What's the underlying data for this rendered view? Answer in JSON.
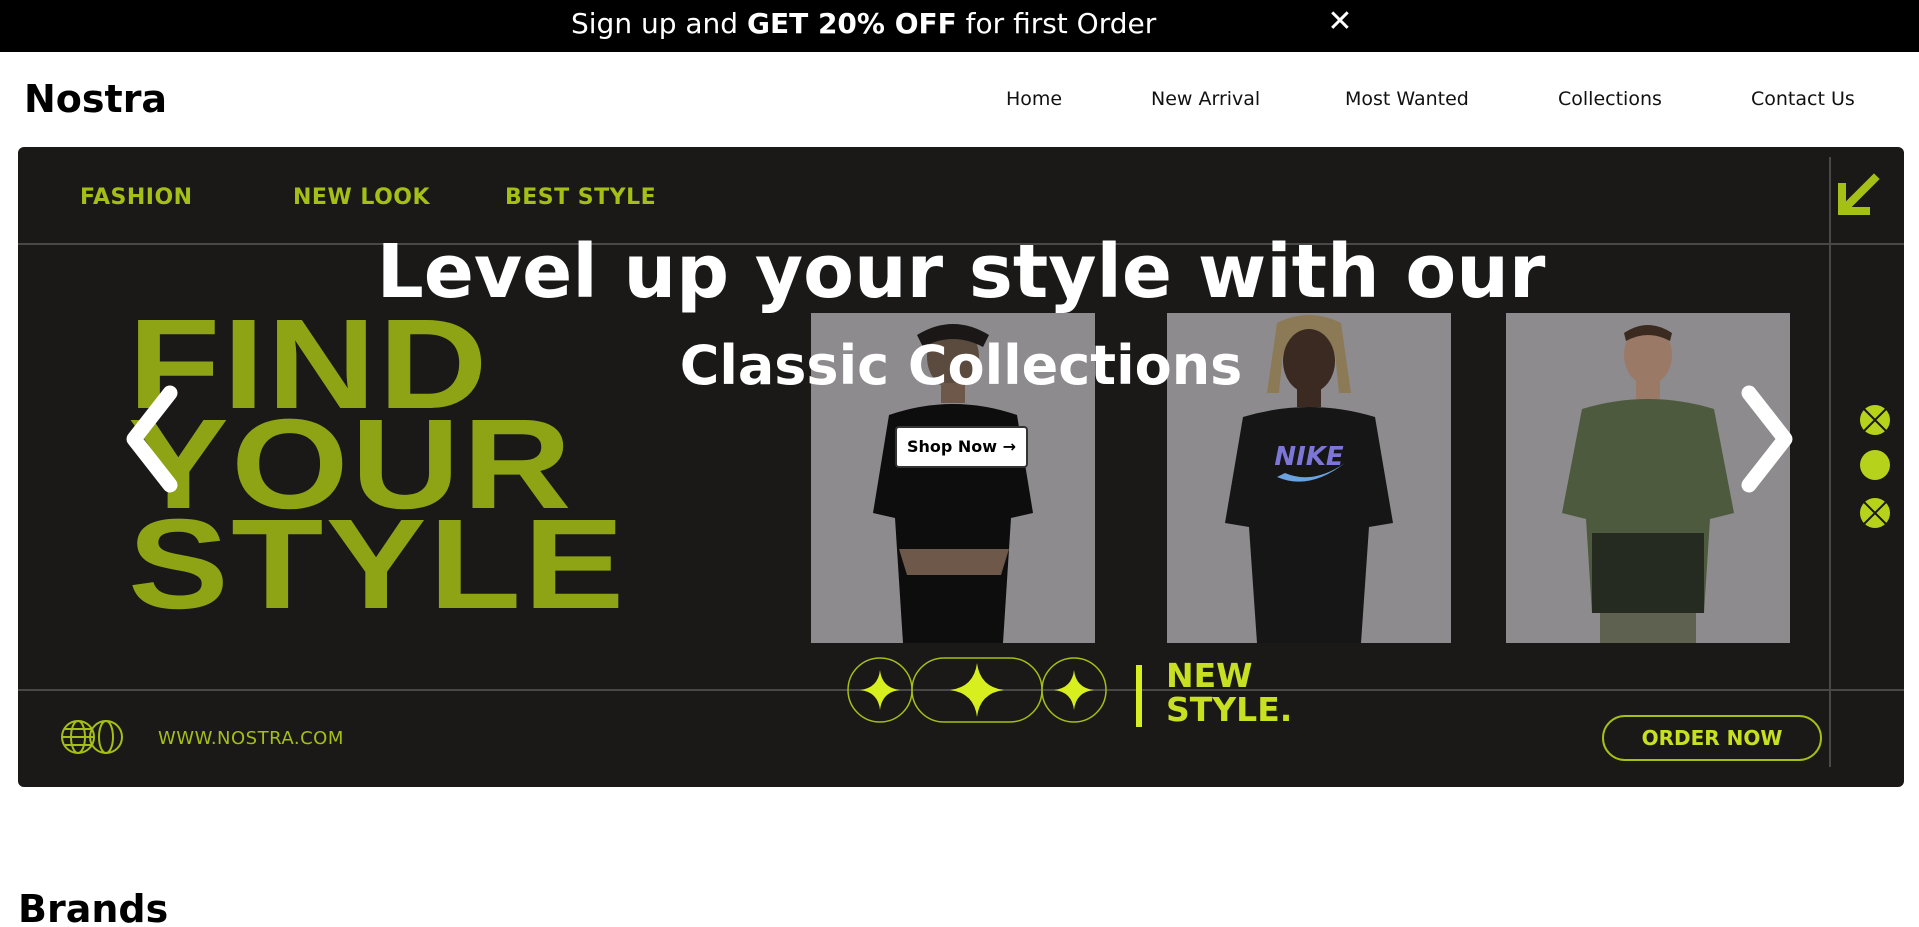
{
  "promo": {
    "text_before": "Sign up and ",
    "text_bold": "GET 20% OFF",
    "text_after": " for first Order",
    "close_label": "✕"
  },
  "header": {
    "brand": "Nostra",
    "nav": [
      {
        "label": "Home"
      },
      {
        "label": "New Arrival"
      },
      {
        "label": "Most Wanted"
      },
      {
        "label": "Collections"
      },
      {
        "label": "Contact Us"
      }
    ]
  },
  "hero": {
    "tags": [
      "FASHION",
      "NEW LOOK",
      "BEST STYLE"
    ],
    "big_lines": [
      "FIND",
      "YOUR",
      "STYLE"
    ],
    "headline": "Level up your style with our",
    "subheadline": "Classic Collections",
    "shop_button": "Shop Now →",
    "new_style_lines": [
      "NEW",
      "STYLE."
    ],
    "url": "WWW.NOSTRA.COM",
    "order_button": "ORDER NOW",
    "accent_color": "#a4bf16",
    "background_color": "#1b1818"
  },
  "sections": {
    "brands_title": "Brands"
  }
}
